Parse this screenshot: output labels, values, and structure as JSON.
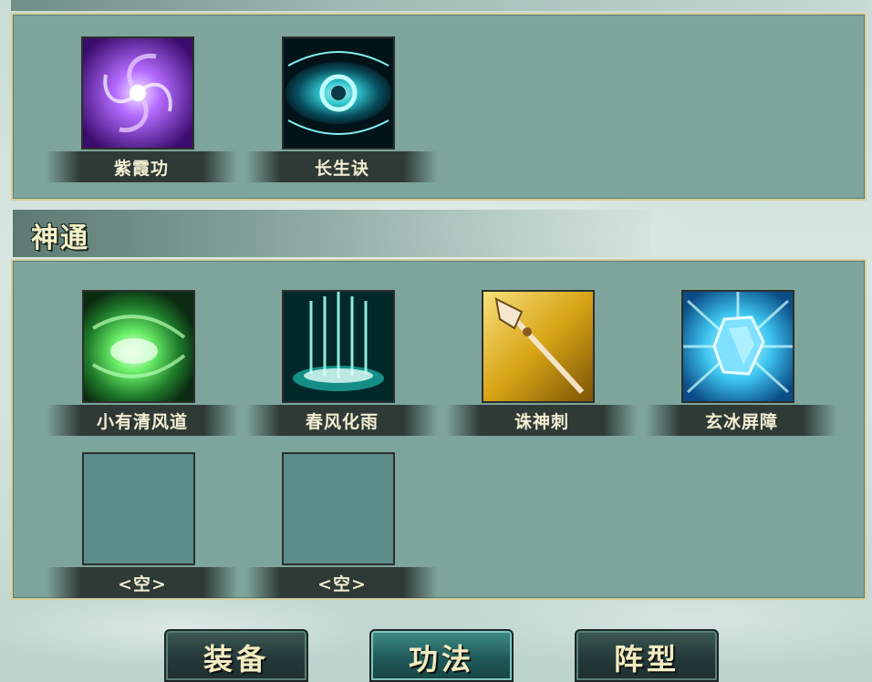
{
  "sections": {
    "top_items": [
      {
        "name": "紫霞功",
        "icon": "purple-vortex-icon"
      },
      {
        "name": "长生诀",
        "icon": "cyan-eye-icon"
      }
    ],
    "shentong": {
      "title": "神通",
      "items": [
        {
          "name": "小有清风道",
          "icon": "green-whirlwind-icon"
        },
        {
          "name": "春风化雨",
          "icon": "cyan-rain-icon"
        },
        {
          "name": "诛神刺",
          "icon": "golden-spear-icon"
        },
        {
          "name": "玄冰屏障",
          "icon": "ice-crystal-icon"
        },
        {
          "name": "<空>",
          "icon": "empty-slot"
        },
        {
          "name": "<空>",
          "icon": "empty-slot"
        }
      ]
    }
  },
  "tabs": [
    {
      "label": "装备",
      "active": false
    },
    {
      "label": "功法",
      "active": true
    },
    {
      "label": "阵型",
      "active": false
    }
  ],
  "colors": {
    "panel": "#7ea59b",
    "panel_border": "#d7cf9a",
    "label_text": "#f2eed2",
    "tab_active": "#1f5a58"
  }
}
